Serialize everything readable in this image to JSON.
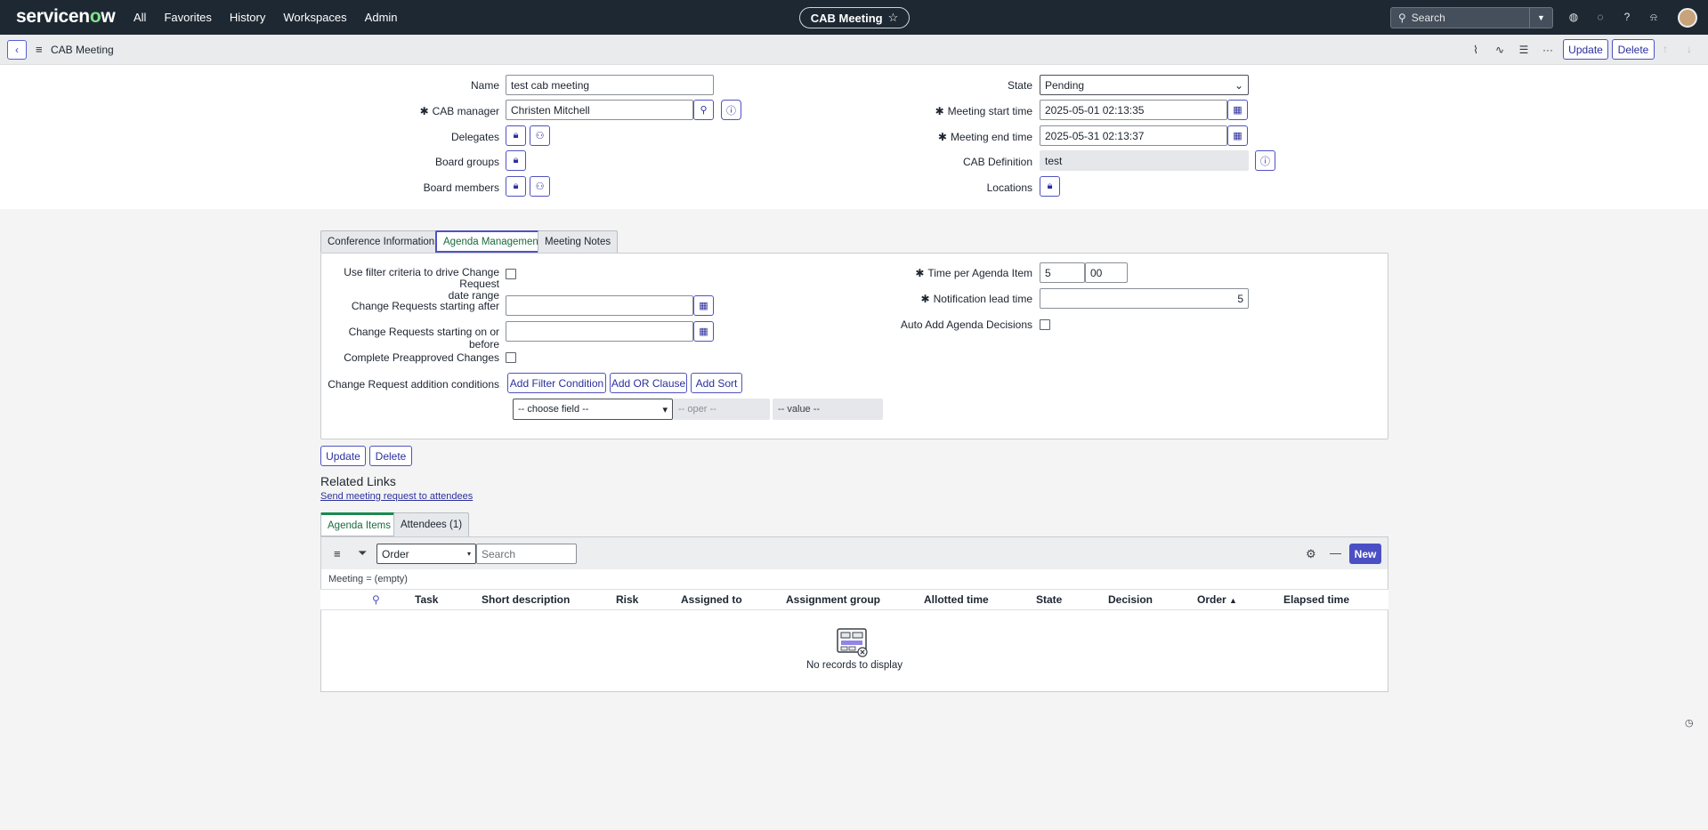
{
  "nav": {
    "logo_main": "servicen",
    "logo_accent": "o",
    "logo_end": "w",
    "items": [
      "All",
      "Favorites",
      "History",
      "Workspaces",
      "Admin"
    ],
    "app_title": "CAB Meeting",
    "search_placeholder": "Search"
  },
  "header": {
    "title": "CAB Meeting",
    "update_label": "Update",
    "delete_label": "Delete"
  },
  "form": {
    "name_label": "Name",
    "name_value": "test cab meeting",
    "cab_manager_label": "CAB manager",
    "cab_manager_value": "Christen Mitchell",
    "delegates_label": "Delegates",
    "board_groups_label": "Board groups",
    "board_members_label": "Board members",
    "state_label": "State",
    "state_value": "Pending",
    "start_label": "Meeting start time",
    "start_value": "2025-05-01 02:13:35",
    "end_label": "Meeting end time",
    "end_value": "2025-05-31 02:13:37",
    "cab_def_label": "CAB Definition",
    "cab_def_value": "test",
    "locations_label": "Locations"
  },
  "tabs": [
    "Conference Information",
    "Agenda Management",
    "Meeting Notes"
  ],
  "agenda": {
    "use_filter_label_1": "Use filter criteria to drive Change Request",
    "use_filter_label_2": "date range",
    "starting_after_label": "Change Requests starting after",
    "starting_before_label": "Change Requests starting on or before",
    "preapproved_label": "Complete Preapproved Changes",
    "conditions_label": "Change Request addition conditions",
    "add_filter_label": "Add Filter Condition",
    "add_or_label": "Add OR Clause",
    "add_sort_label": "Add Sort",
    "choose_field": "-- choose field --",
    "oper": "-- oper --",
    "value": "-- value --",
    "time_per_item_label": "Time per Agenda Item",
    "time_min": "5",
    "time_sec": "00",
    "notif_label": "Notification lead time",
    "notif_value": "5",
    "auto_add_label": "Auto Add Agenda Decisions"
  },
  "bottom_buttons": {
    "update": "Update",
    "delete": "Delete"
  },
  "related_links": {
    "title": "Related Links",
    "link": "Send meeting request to attendees"
  },
  "related_tabs": [
    "Agenda Items",
    "Attendees (1)"
  ],
  "list": {
    "sort_field": "Order",
    "search_placeholder": "Search",
    "new_label": "New",
    "filter_breadcrumb": "Meeting = (empty)",
    "columns": [
      "Task",
      "Short description",
      "Risk",
      "Assigned to",
      "Assignment group",
      "Allotted time",
      "State",
      "Decision",
      "Order",
      "Elapsed time"
    ],
    "empty_message": "No records to display"
  },
  "colors": {
    "accent": "#4f52c2",
    "nav_bg": "#1e2832",
    "active_tab_text": "#1a6b3e",
    "new_button": "#4b4fc4"
  }
}
